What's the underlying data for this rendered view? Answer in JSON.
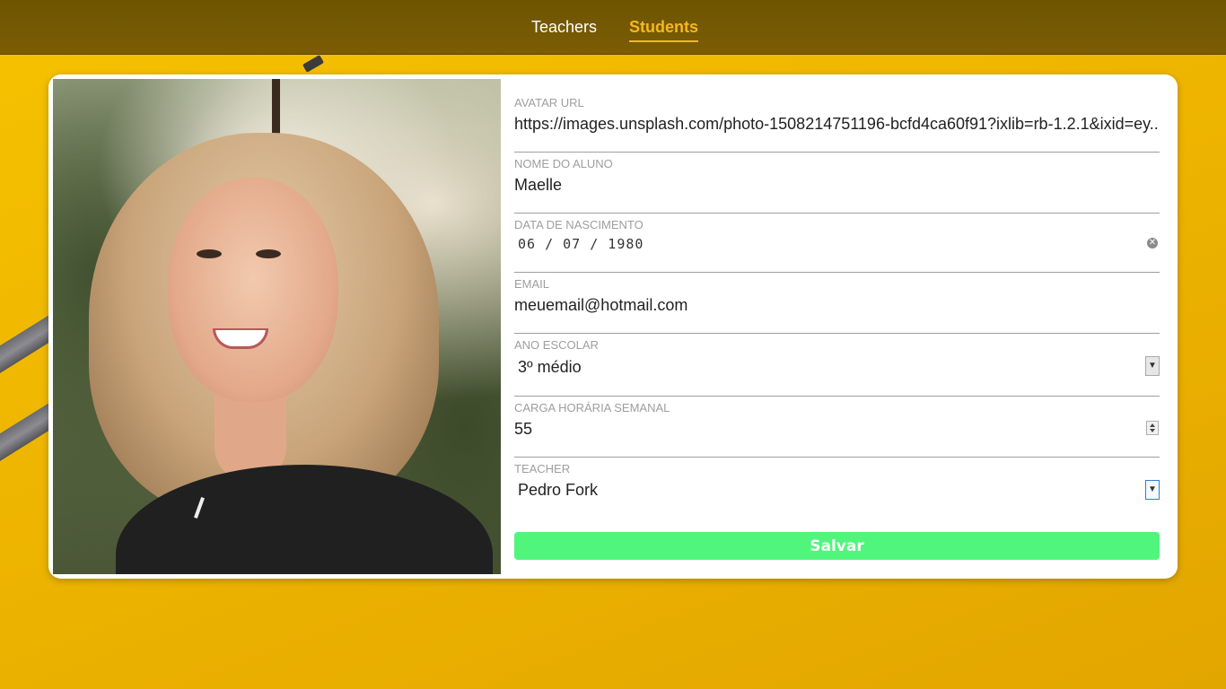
{
  "nav": {
    "items": [
      {
        "label": "Teachers",
        "active": false
      },
      {
        "label": "Students",
        "active": true
      }
    ]
  },
  "student": {
    "photo_alt": "student-photo"
  },
  "form": {
    "avatar_url": {
      "label": "AVATAR URL",
      "value": "https://images.unsplash.com/photo-1508214751196-bcfd4ca60f91?ixlib=rb-1.2.1&ixid=ey..."
    },
    "name": {
      "label": "NOME DO ALUNO",
      "value": "Maelle"
    },
    "birth_date": {
      "label": "DATA DE NASCIMENTO",
      "value": "06 / 07 / 1980"
    },
    "email": {
      "label": "EMAIL",
      "value": "meuemail@hotmail.com"
    },
    "school_year": {
      "label": "ANO ESCOLAR",
      "value": "3º médio"
    },
    "weekly_hours": {
      "label": "CARGA HORÁRIA SEMANAL",
      "value": "55"
    },
    "teacher": {
      "label": "TEACHER",
      "value": "Pedro Fork"
    }
  },
  "actions": {
    "save_label": "Salvar"
  },
  "colors": {
    "navbar": "#7a5d05",
    "active_nav": "#f4b81e",
    "background": "#f2bb00",
    "save_button": "#50f57b"
  }
}
